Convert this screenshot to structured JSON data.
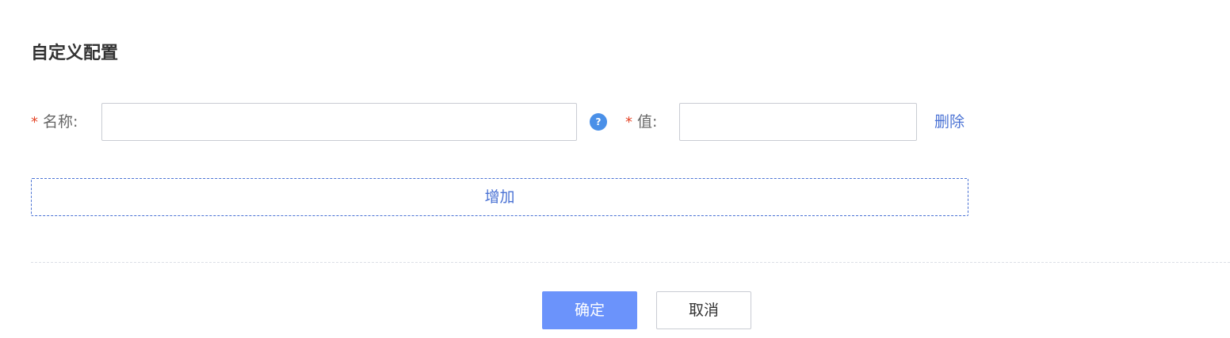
{
  "page": {
    "title": "自定义配置"
  },
  "form": {
    "name_label": "名称:",
    "name_required": "*",
    "name_value": "",
    "help_icon_glyph": "?",
    "value_label": "值:",
    "value_required": "*",
    "value_value": "",
    "delete_label": "删除",
    "add_label": "增加"
  },
  "footer": {
    "confirm_label": "确定",
    "cancel_label": "取消"
  },
  "colors": {
    "primary": "#6b93fb",
    "link": "#4a72d4",
    "required": "#e5482b",
    "help_icon": "#4a90e8"
  }
}
